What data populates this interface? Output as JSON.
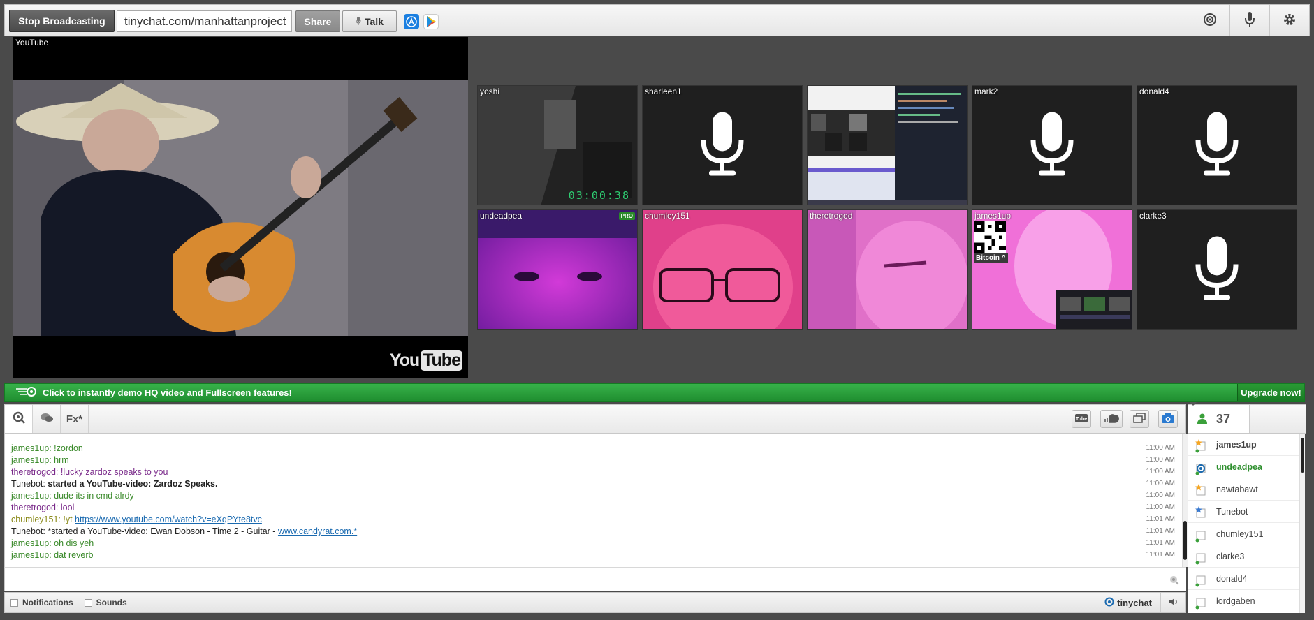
{
  "toolbar": {
    "stop_broadcasting": "Stop Broadcasting",
    "room_url": "tinychat.com/manhattanproject",
    "share": "Share",
    "talk": "Talk"
  },
  "youtube_panel": {
    "label": "YouTube",
    "logo_you": "You",
    "logo_tube": "Tube"
  },
  "cameras": [
    {
      "name": "yoshi",
      "kind": "video",
      "timestamp": "03:00:38"
    },
    {
      "name": "sharleen1",
      "kind": "mic"
    },
    {
      "name": "",
      "kind": "screen"
    },
    {
      "name": "mark2",
      "kind": "mic"
    },
    {
      "name": "donald4",
      "kind": "mic"
    },
    {
      "name": "undeadpea",
      "kind": "video",
      "badge": "PRO"
    },
    {
      "name": "chumley151",
      "kind": "video"
    },
    {
      "name": "theretrogod",
      "kind": "video"
    },
    {
      "name": "james1up",
      "kind": "video",
      "qr_label": "Bitcoin ^"
    },
    {
      "name": "clarke3",
      "kind": "mic"
    }
  ],
  "upgrade_bar": {
    "text": "Click to instantly demo HQ video and Fullscreen features!",
    "button": "Upgrade now!"
  },
  "chat_tabs": {
    "fx": "Fx*"
  },
  "chat": {
    "messages": [
      {
        "user": "james1up:",
        "text": "!zordon",
        "time": "11:00 AM",
        "color": "#3a8a2a"
      },
      {
        "user": "james1up:",
        "text": "hrm",
        "time": "11:00 AM",
        "color": "#3a8a2a"
      },
      {
        "user": "theretrogod:",
        "text": "!lucky zardoz speaks to you",
        "time": "11:00 AM",
        "color": "#7a2a8a"
      },
      {
        "user": "Tunebot:",
        "text": "started a YouTube-video: Zardoz Speaks.",
        "time": "11:00 AM",
        "color": "#222"
      },
      {
        "user": "james1up:",
        "text": "dude its in cmd alrdy",
        "time": "11:00 AM",
        "color": "#3a8a2a"
      },
      {
        "user": "theretrogod:",
        "text": "lool",
        "time": "11:00 AM",
        "color": "#7a2a8a"
      },
      {
        "user": "chumley151:",
        "text": "!yt",
        "link": "https://www.youtube.com/watch?v=eXqPYte8tvc",
        "time": "11:01 AM",
        "color": "#8a8a1a"
      },
      {
        "user": "Tunebot:",
        "text": "*started a YouTube-video: Ewan Dobson - Time 2 - Guitar -",
        "link": "www.candyrat.com.*",
        "time": "11:01 AM",
        "color": "#222"
      },
      {
        "user": "james1up:",
        "text": "oh dis yeh",
        "time": "11:01 AM",
        "color": "#3a8a2a"
      },
      {
        "user": "james1up:",
        "text": "dat reverb",
        "time": "11:01 AM",
        "color": "#3a8a2a"
      }
    ]
  },
  "footer": {
    "notifications": "Notifications",
    "sounds": "Sounds",
    "brand": "tinychat"
  },
  "users": {
    "count": "37",
    "list": [
      {
        "name": "james1up",
        "bold": true,
        "color": "#444",
        "star": true
      },
      {
        "name": "undeadpea",
        "bold": true,
        "color": "#2f8f2f",
        "star": false,
        "cam": true
      },
      {
        "name": "nawtabawt",
        "bold": false,
        "color": "#444",
        "star": true
      },
      {
        "name": "Tunebot",
        "bold": false,
        "color": "#444",
        "star": true
      },
      {
        "name": "chumley151",
        "bold": false,
        "color": "#444",
        "star": false
      },
      {
        "name": "clarke3",
        "bold": false,
        "color": "#444",
        "star": false
      },
      {
        "name": "donald4",
        "bold": false,
        "color": "#444",
        "star": false
      },
      {
        "name": "lordgaben",
        "bold": false,
        "color": "#444",
        "star": false
      }
    ]
  }
}
